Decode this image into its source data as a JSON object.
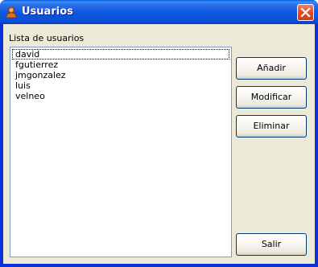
{
  "window": {
    "title": "Usuarios",
    "app_icon": "user-silhouette-icon",
    "close_icon": "close-icon",
    "accent_color": "#0a4fd8",
    "close_color": "#d9542f"
  },
  "list": {
    "label": "Lista de usuarios",
    "items": [
      "david",
      "fgutierrez",
      "jmgonzalez",
      "luis",
      "velneo"
    ],
    "focused_index": 0
  },
  "buttons": {
    "add": "Añadir",
    "modify": "Modificar",
    "delete": "Eliminar",
    "exit": "Salir"
  }
}
